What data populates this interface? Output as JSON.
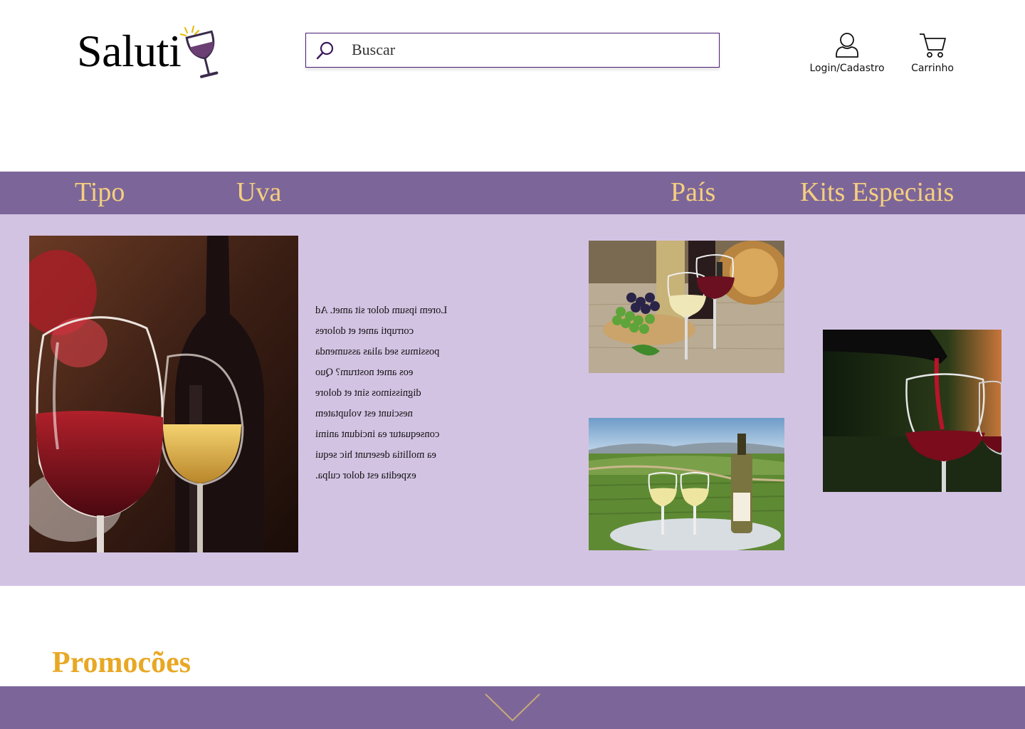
{
  "header": {
    "logo_text": "Saluti",
    "search_placeholder": "Buscar",
    "login_label": "Login/Cadastro",
    "cart_label": "Carrinho"
  },
  "nav": {
    "items": [
      {
        "label": "Tipo"
      },
      {
        "label": "Uva"
      },
      {
        "label": "País"
      },
      {
        "label": "Kits Especiais"
      }
    ]
  },
  "hero": {
    "mirrored_text": "Lorem ipsum dolor sit amet. Ad\ncorrupti amet et dolores\npossimus sed alias assumenda\neos amet nostrum? Quo\ndignissimos sint et dolore\nnesciunt est voluptatem\nconsequatur ea incidunt animi\nea mollitia deserunt hic sequi\nexpedita est dolor culpa."
  },
  "promo": {
    "title": "Promocões"
  },
  "colors": {
    "nav_bg": "#7c6699",
    "nav_text": "#f5cf7f",
    "hero_bg": "#d3c3e3",
    "promo_title": "#e8a825",
    "search_border": "#4b1e74"
  },
  "icons": {
    "logo": "wine-glass-icon",
    "search": "search-icon",
    "login": "user-icon",
    "cart": "cart-icon",
    "scroll": "chevron-down-icon"
  }
}
